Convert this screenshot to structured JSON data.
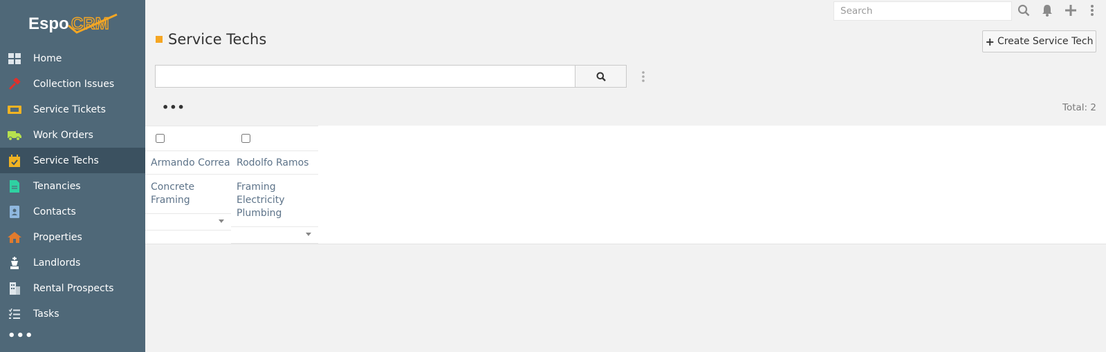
{
  "app": {
    "logo_text": "EspoCRM",
    "accent_color": "#f5a623"
  },
  "sidebar": {
    "items": [
      {
        "label": "Home",
        "icon": "home-grid-icon",
        "color": "#dfe6eb"
      },
      {
        "label": "Collection Issues",
        "icon": "hammer-icon",
        "color": "#e0302a"
      },
      {
        "label": "Service Tickets",
        "icon": "ticket-icon",
        "color": "#f0b323"
      },
      {
        "label": "Work Orders",
        "icon": "truck-icon",
        "color": "#b6e14e"
      },
      {
        "label": "Service Techs",
        "icon": "calendar-check-icon",
        "color": "#f0b323"
      },
      {
        "label": "Tenancies",
        "icon": "document-icon",
        "color": "#2fd1a2"
      },
      {
        "label": "Contacts",
        "icon": "id-card-icon",
        "color": "#8fb8df"
      },
      {
        "label": "Properties",
        "icon": "house-icon",
        "color": "#e27b2d"
      },
      {
        "label": "Landlords",
        "icon": "chess-king-icon",
        "color": "#ffffff"
      },
      {
        "label": "Rental Prospects",
        "icon": "building-icon",
        "color": "#dfe6eb"
      },
      {
        "label": "Tasks",
        "icon": "tasks-icon",
        "color": "#dfe6eb"
      }
    ],
    "active_item": "Service Techs",
    "more_label": "•••"
  },
  "topbar": {
    "search_placeholder": "Search"
  },
  "header": {
    "title": "Service Techs",
    "create_button_label": "Create Service Tech"
  },
  "search": {
    "value": "",
    "placeholder": ""
  },
  "list": {
    "actions_label": "•••",
    "total_label": "Total: 2",
    "columns": [
      {
        "name": "Armando Correa",
        "skills": [
          "Concrete",
          "Framing"
        ]
      },
      {
        "name": "Rodolfo Ramos",
        "skills": [
          "Framing",
          "Electricity",
          "Plumbing"
        ]
      }
    ]
  }
}
